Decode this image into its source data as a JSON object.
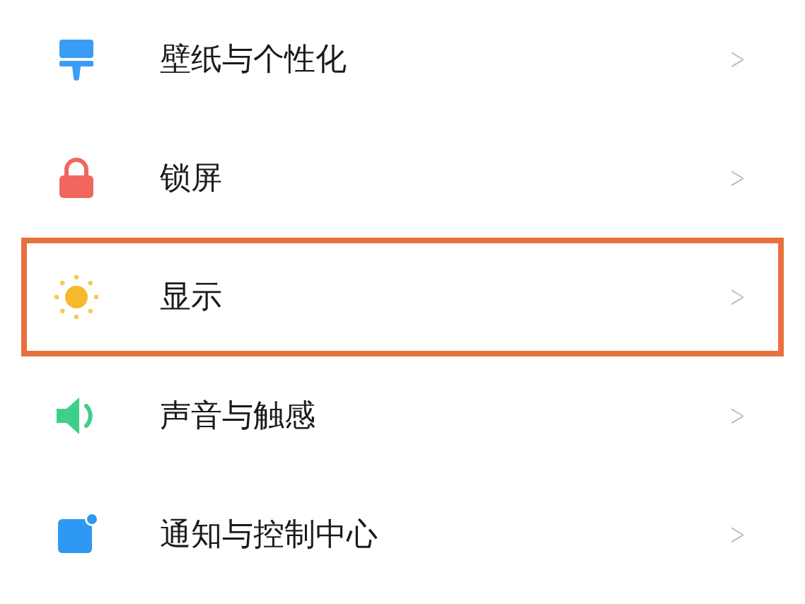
{
  "settings_items": [
    {
      "kind": "wallpaper",
      "label": "壁纸与个性化",
      "highlighted": false,
      "chevron": ">"
    },
    {
      "kind": "lock",
      "label": "锁屏",
      "highlighted": false,
      "chevron": ">"
    },
    {
      "kind": "display",
      "label": "显示",
      "highlighted": true,
      "chevron": ">"
    },
    {
      "kind": "sound",
      "label": "声音与触感",
      "highlighted": false,
      "chevron": ">"
    },
    {
      "kind": "notification",
      "label": "通知与控制中心",
      "highlighted": false,
      "chevron": ">"
    }
  ]
}
